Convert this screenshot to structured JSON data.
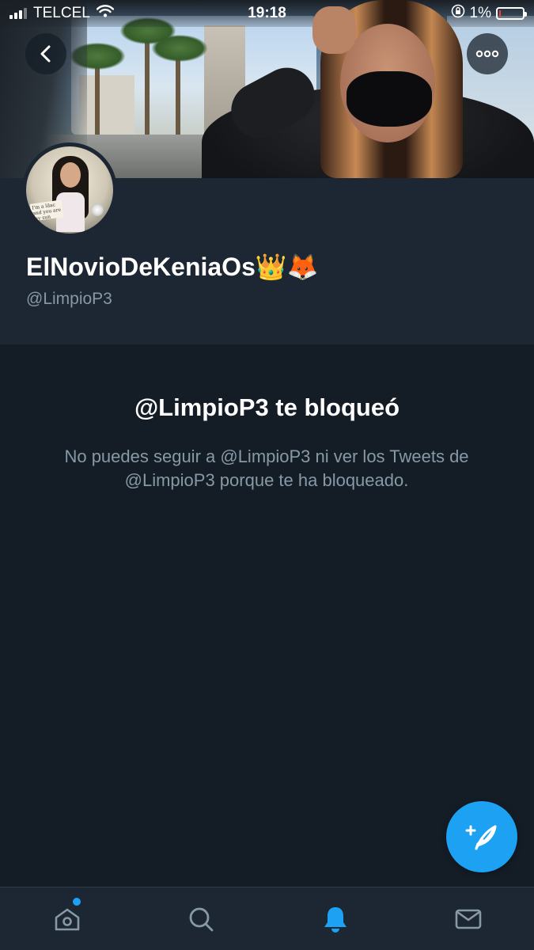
{
  "status_bar": {
    "carrier": "TELCEL",
    "time": "19:18",
    "battery": "1%",
    "battery_level": 0.01
  },
  "profile": {
    "display_name": "ElNovioDeKeniaOs👑🦊",
    "handle": "@LimpioP3",
    "avatar_caption": "I'm a lilac and you are my sun"
  },
  "blocked": {
    "title": "@LimpioP3 te bloqueó",
    "description": "No puedes seguir a @LimpioP3 ni ver los Tweets de @LimpioP3 porque te ha bloqueado."
  },
  "icons": {
    "back": "chevron-left-icon",
    "more": "more-horizontal-icon",
    "compose": "feather-plus-icon",
    "home": "home-icon",
    "search": "search-icon",
    "notifications": "bell-icon",
    "messages": "envelope-icon"
  },
  "tabbar": {
    "active": "notifications",
    "home_has_new": true
  },
  "colors": {
    "background": "#141d26",
    "header": "#1c2733",
    "accent": "#1da1f2",
    "secondary_text": "#8899a6",
    "icon_inactive": "#8899a6"
  }
}
